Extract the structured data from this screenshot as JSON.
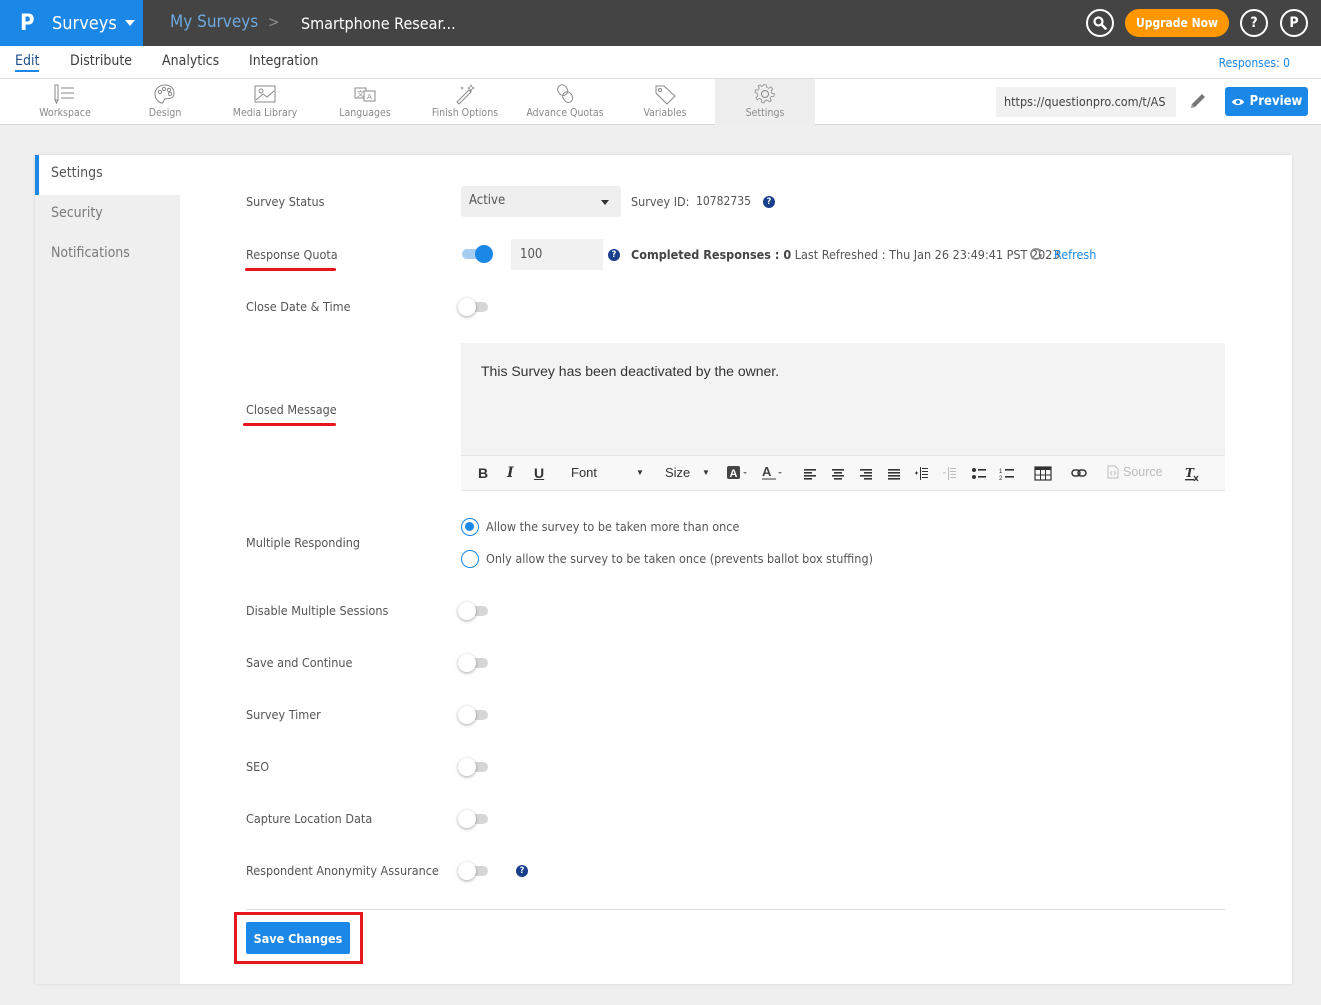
{
  "topbar": {
    "logo": "P",
    "app_label": "Surveys",
    "breadcrumb_root": "My Surveys",
    "breadcrumb_sep": ">",
    "breadcrumb_current": "Smartphone Resear...",
    "upgrade_label": "Upgrade Now",
    "help_label": "?",
    "avatar_label": "P"
  },
  "nav": {
    "tabs": [
      {
        "label": "Edit",
        "active": true
      },
      {
        "label": "Distribute"
      },
      {
        "label": "Analytics"
      },
      {
        "label": "Integration"
      }
    ],
    "responses": "Responses: 0"
  },
  "toolbar": {
    "tools": [
      {
        "label": "Workspace",
        "icon": "workspace-icon"
      },
      {
        "label": "Design",
        "icon": "palette-icon"
      },
      {
        "label": "Media Library",
        "icon": "image-icon"
      },
      {
        "label": "Languages",
        "icon": "translate-icon"
      },
      {
        "label": "Finish Options",
        "icon": "magic-wand-icon"
      },
      {
        "label": "Advance Quotas",
        "icon": "chain-link-icon"
      },
      {
        "label": "Variables",
        "icon": "tag-icon"
      },
      {
        "label": "Settings",
        "icon": "gear-icon",
        "active": true
      }
    ],
    "survey_url": "https://questionpro.com/t/AS",
    "preview_label": "Preview"
  },
  "sidebar": {
    "items": [
      {
        "label": "Settings",
        "active": true
      },
      {
        "label": "Security"
      },
      {
        "label": "Notifications"
      }
    ]
  },
  "settings": {
    "survey_status_label": "Survey Status",
    "survey_status_value": "Active",
    "survey_id_label": "Survey ID:",
    "survey_id_value": "10782735",
    "response_quota_label": "Response Quota",
    "response_quota_enabled": true,
    "response_quota_value": "100",
    "completed_label": "Completed Responses : 0",
    "last_refreshed": "Last Refreshed : Thu Jan 26 23:49:41 PST 2023",
    "refresh_label": "Refresh",
    "close_date_label": "Close Date & Time",
    "close_date_enabled": false,
    "closed_message_label": "Closed Message",
    "closed_message_text": "This Survey has been deactivated by the owner.",
    "editor": {
      "bold": "B",
      "italic": "I",
      "underline": "U",
      "font": "Font",
      "size": "Size",
      "source": "Source"
    },
    "multiple_responding_label": "Multiple Responding",
    "multiple_options": [
      {
        "label": "Allow the survey to be taken more than once",
        "checked": true
      },
      {
        "label": "Only allow the survey to be taken once (prevents ballot box stuffing)",
        "checked": false
      }
    ],
    "toggles": [
      {
        "label": "Disable Multiple Sessions",
        "enabled": false
      },
      {
        "label": "Save and Continue",
        "enabled": false
      },
      {
        "label": "Survey Timer",
        "enabled": false
      },
      {
        "label": "SEO",
        "enabled": false
      },
      {
        "label": "Capture Location Data",
        "enabled": false
      },
      {
        "label": "Respondent Anonymity Assurance",
        "enabled": false
      }
    ],
    "save_label": "Save Changes"
  },
  "colors": {
    "brand": "#1b87e6",
    "topbar": "#444444",
    "upgrade": "#ff9800",
    "highlight": "#e8141e"
  }
}
